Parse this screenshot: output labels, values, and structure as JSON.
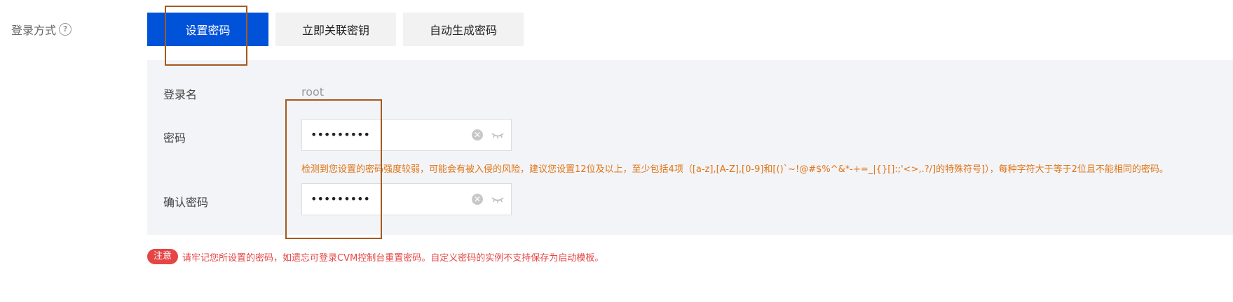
{
  "login_method": {
    "label": "登录方式",
    "help_icon": "question-circle-icon"
  },
  "tabs": [
    {
      "label": "设置密码",
      "active": true
    },
    {
      "label": "立即关联密钥",
      "active": false
    },
    {
      "label": "自动生成密码",
      "active": false
    }
  ],
  "form": {
    "username_label": "登录名",
    "username_value": "root",
    "password_label": "密码",
    "password_value": "•••••••••",
    "confirm_label": "确认密码",
    "confirm_value": "•••••••••",
    "warning": "检测到您设置的密码强度较弱，可能会有被入侵的风险，建议您设置12位及以上，至少包括4项（[a-z],[A-Z],[0-9]和[()`~!@#$%^&*-+=_|{}[]:;'<>,.?/]的特殊符号]），每种字符大于等于2位且不能相同的密码。"
  },
  "note": {
    "badge": "注意",
    "text": "请牢记您所设置的密码，如遗忘可登录CVM控制台重置密码。自定义密码的实例不支持保存为启动模板。"
  },
  "colors": {
    "primary": "#0052d9",
    "warning": "#e07516",
    "danger": "#e54545",
    "highlight": "#a45a1e"
  }
}
